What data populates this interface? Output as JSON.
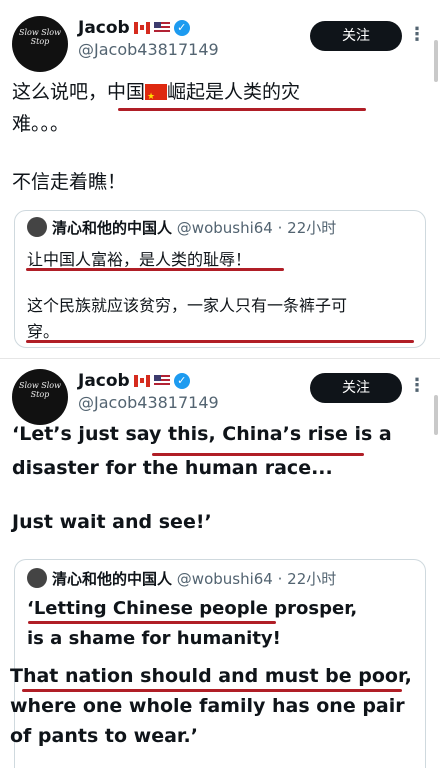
{
  "tweet1": {
    "avatar_text": "Slow Slow Stop",
    "name": "Jacob",
    "handle": "@Jacob43817149",
    "follow_label": "关注",
    "more_label": "⋮",
    "text_line1_pre": "这么说吧，",
    "text_line1_a": "中国",
    "text_line1_b": "崛起是人类的灾",
    "text_line2": "难。。。",
    "text_line3": "不信走着瞧！",
    "quote": {
      "name": "清心和他的中国人",
      "meta": "@wobushi64 · 22小时",
      "line1": "让中国人富裕，是人类的耻辱！",
      "line2": "这个民族就应该贫穷，一家人只有一条裤子可",
      "line3": "穿。"
    }
  },
  "tweet2": {
    "avatar_text": "Slow Slow Stop",
    "name": "Jacob",
    "handle": "@Jacob43817149",
    "follow_label": "关注",
    "more_label": "⋮",
    "line1": "‘Let’s just say this, China’s rise is a",
    "line2": "disaster for the human race...",
    "line3": "Just wait and see!’",
    "quote": {
      "name": "清心和他的中国人",
      "meta": "@wobushi64 · 22小时",
      "line1": "‘Letting Chinese people prosper,",
      "line2": "is a shame for humanity!",
      "line3": "That nation should and must be poor,",
      "line4": "where one whole family has one pair",
      "line5": "of pants to wear.’"
    }
  },
  "colors": {
    "underline": "#b01e26",
    "verified": "#1d9bf0",
    "button": "#0f1419"
  }
}
